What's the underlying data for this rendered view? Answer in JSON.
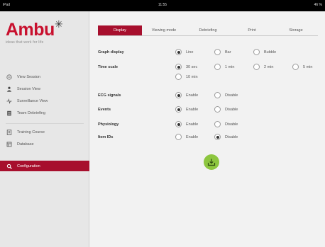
{
  "status_bar": {
    "device": "iPad",
    "time": "11:55",
    "battery": "46 %"
  },
  "logo": {
    "brand": "Ambu",
    "tagline": "ideas that work for life"
  },
  "sidebar": {
    "items": [
      {
        "label": "View Session",
        "icon": "view-session-icon"
      },
      {
        "label": "Session View",
        "icon": "session-view-icon"
      },
      {
        "label": "Surveillance View",
        "icon": "surveillance-icon"
      },
      {
        "label": "Team Debriefing",
        "icon": "debriefing-icon"
      },
      {
        "label": "Training Course",
        "icon": "training-course-icon"
      },
      {
        "label": "Database",
        "icon": "database-icon"
      },
      {
        "label": "Configuration",
        "icon": "configuration-icon",
        "active": true
      }
    ]
  },
  "tabs": [
    {
      "label": "Display",
      "active": true
    },
    {
      "label": "Viewing mode"
    },
    {
      "label": "Debriefing"
    },
    {
      "label": "Print"
    },
    {
      "label": "Storage"
    }
  ],
  "settings": {
    "graph_display": {
      "label": "Graph display",
      "options": [
        "Line",
        "Bar",
        "Bubble"
      ],
      "selected": "Line"
    },
    "time_scale": {
      "label": "Time scale",
      "options": [
        "30 sec",
        "1 min",
        "2 min",
        "5 min",
        "10 min"
      ],
      "selected": "30 sec"
    },
    "ecg_signals": {
      "label": "ECG signals",
      "options": [
        "Enable",
        "Disable"
      ],
      "selected": "Enable"
    },
    "events": {
      "label": "Events",
      "options": [
        "Enable",
        "Disable"
      ],
      "selected": "Enable"
    },
    "physiology": {
      "label": "Physiology",
      "options": [
        "Enable",
        "Disable"
      ],
      "selected": "Enable"
    },
    "item_ids": {
      "label": "Item IDs",
      "options": [
        "Enable",
        "Disable"
      ],
      "selected": "Disable"
    }
  },
  "save_button": {
    "icon": "save-download-icon"
  },
  "colors": {
    "accent": "#a70f2d",
    "brand": "#c8102e",
    "save": "#8dc63f"
  }
}
